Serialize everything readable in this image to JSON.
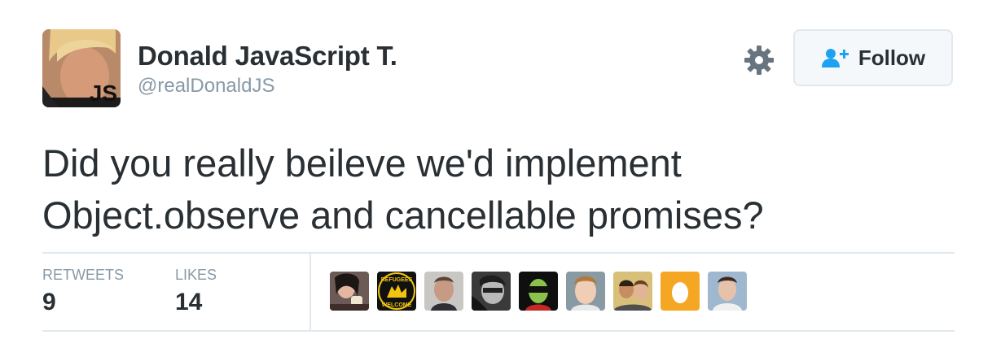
{
  "user": {
    "name": "Donald JavaScript T.",
    "handle": "@realDonaldJS",
    "avatar_badge": "JS"
  },
  "actions": {
    "follow_label": "Follow",
    "settings_icon": "gear-icon",
    "follow_icon": "add-user-icon"
  },
  "tweet": {
    "text": "Did you really beileve we'd implement\nObject.observe and cancellable promises?"
  },
  "stats": {
    "retweets_label": "RETWEETS",
    "retweets_count": "9",
    "likes_label": "LIKES",
    "likes_count": "14"
  },
  "likers": [
    "avatar-person-1",
    "avatar-refugees-welcome",
    "avatar-person-3",
    "avatar-person-4",
    "avatar-person-5",
    "avatar-person-6",
    "avatar-person-7",
    "avatar-default-egg",
    "avatar-person-9"
  ],
  "liker_badge_text": {
    "top": "REFUGEES",
    "bottom": "WELCOME"
  },
  "colors": {
    "text": "#292f33",
    "muted": "#8899a6",
    "border": "#e1e8ed",
    "button_bg": "#f5f8fa",
    "follow_icon": "#1da1f2",
    "egg_bg": "#f5a623"
  }
}
